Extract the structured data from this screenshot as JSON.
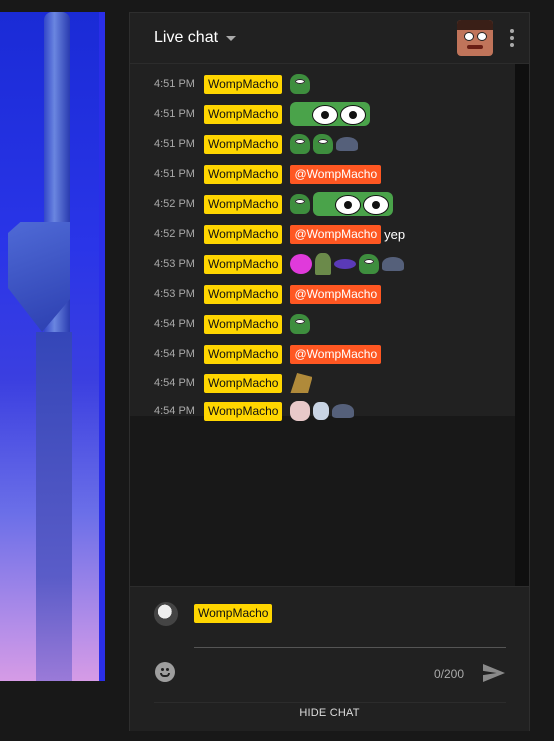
{
  "chat": {
    "title": "Live chat",
    "messages": [
      {
        "time": "4:51 PM",
        "author": "WompMacho",
        "emotes": [
          "pepe"
        ]
      },
      {
        "time": "4:51 PM",
        "author": "WompMacho",
        "emotes": [
          "eyes"
        ]
      },
      {
        "time": "4:51 PM",
        "author": "WompMacho",
        "emotes": [
          "pepe",
          "pepe",
          "snail"
        ]
      },
      {
        "time": "4:51 PM",
        "author": "WompMacho",
        "mention": "@WompMacho"
      },
      {
        "time": "4:52 PM",
        "author": "WompMacho",
        "emotes": [
          "pepe",
          "eyes"
        ]
      },
      {
        "time": "4:52 PM",
        "author": "WompMacho",
        "mention": "@WompMacho",
        "text": "yep"
      },
      {
        "time": "4:53 PM",
        "author": "WompMacho",
        "emotes": [
          "pink",
          "hat",
          "blob",
          "pepe",
          "snail"
        ]
      },
      {
        "time": "4:53 PM",
        "author": "WompMacho",
        "mention": "@WompMacho"
      },
      {
        "time": "4:54 PM",
        "author": "WompMacho",
        "emotes": [
          "pepe"
        ]
      },
      {
        "time": "4:54 PM",
        "author": "WompMacho",
        "mention": "@WompMacho"
      },
      {
        "time": "4:54 PM",
        "author": "WompMacho",
        "emotes": [
          "gold"
        ]
      },
      {
        "time": "4:54 PM",
        "author": "WompMacho",
        "emotes": [
          "girl",
          "bunny",
          "snail"
        ]
      }
    ],
    "compose": {
      "author": "WompMacho",
      "placeholder": "",
      "counter": "0/200"
    },
    "hide_label": "HIDE CHAT"
  },
  "colors": {
    "author_badge": "#ffd600",
    "mention": "#ff5722",
    "panel": "#212121",
    "background": "#181818"
  }
}
